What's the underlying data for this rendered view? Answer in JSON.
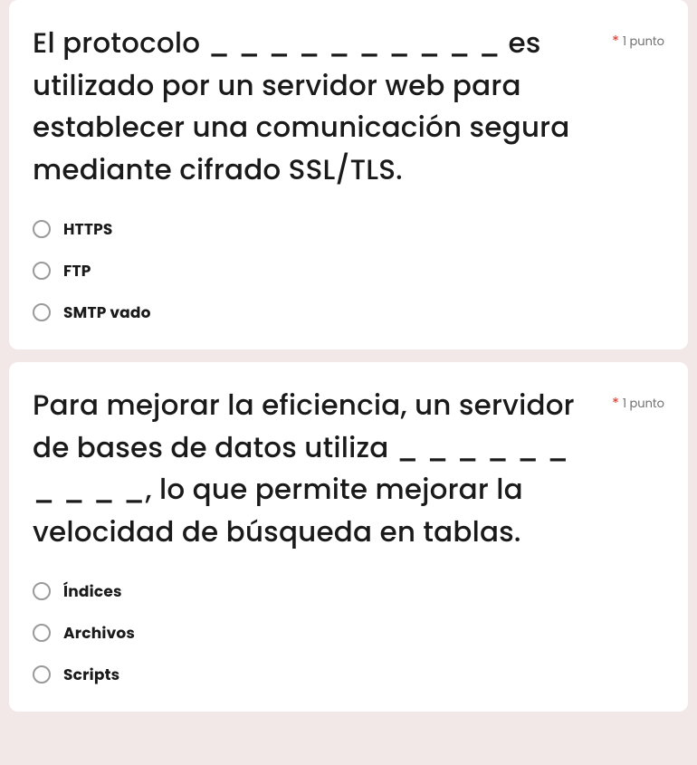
{
  "questions": [
    {
      "text": "El protocolo _ _ _ _ _ _ _ _ _ _ es utilizado por un servidor web para establecer una comunicación segura mediante cifrado SSL/TLS.",
      "required_mark": "*",
      "points_label": "1 punto",
      "options": [
        {
          "label": "HTTPS"
        },
        {
          "label": "FTP"
        },
        {
          "label": "SMTP vado"
        }
      ]
    },
    {
      "text": "Para mejorar la eficiencia, un servidor de bases de datos utiliza _ _ _ _ _ _ _ _ _ _, lo que permite mejorar la velocidad de búsqueda en tablas.",
      "required_mark": "*",
      "points_label": "1 punto",
      "options": [
        {
          "label": "Índices"
        },
        {
          "label": "Archivos"
        },
        {
          "label": "Scripts"
        }
      ]
    }
  ]
}
